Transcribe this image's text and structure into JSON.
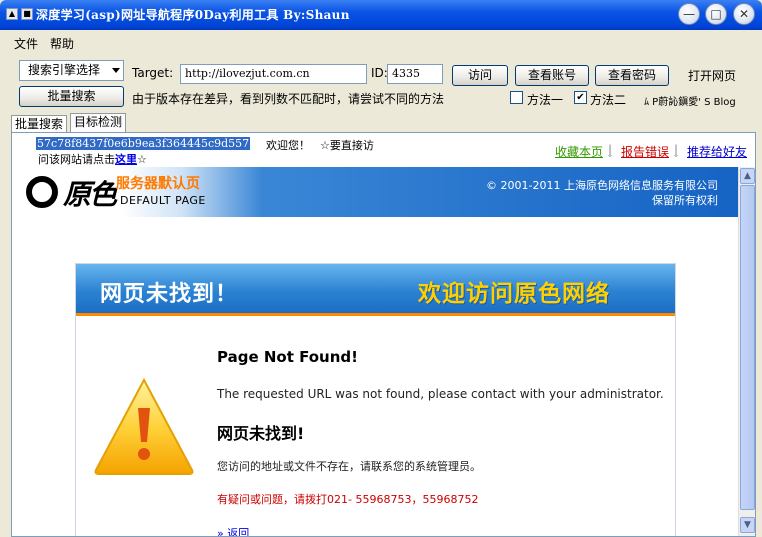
{
  "window": {
    "title": "深度学习(asp)网址导航程序0Day利用工具 By:Shaun",
    "controls": {
      "minimize": "—",
      "maximize": "□",
      "close": "✕"
    }
  },
  "menu": {
    "items": [
      "文件",
      "帮助"
    ]
  },
  "toolbar": {
    "search_engine_select": "搜索引擎选择",
    "target_label": "Target:",
    "target_value": "http://ilovezjut.com.cn",
    "id_label": "ID:",
    "id_value": "4335",
    "visit_button": "访问",
    "view_account_button": "查看账号",
    "view_password_button": "查看密码",
    "open_page_button": "打开网页",
    "batch_search_button": "批量搜索",
    "notice": "由于版本存在差异，看到列数不匹配时，请尝试不同的方法",
    "method1_label": "方法一",
    "method1_checked": false,
    "method2_label": "方法二",
    "method2_checked": true,
    "blog_text": "ﾑ P蔚訫鎭愛' S Blog"
  },
  "tabs": [
    "批量搜索",
    "目标检测"
  ],
  "browser": {
    "hash": "57c78f8437f0e6b9ea3f364445c9d557",
    "welcome": "欢迎您！",
    "direct": "☆要直接访",
    "visit_prefix": "问该网站请点击",
    "visit_link": "这里",
    "visit_suffix": "☆",
    "links": [
      "收藏本页",
      "报告错误",
      "推荐给好友"
    ],
    "link_colors": [
      "#339900",
      "#cc0000",
      "#0000cc"
    ],
    "logo_text": "原色",
    "server_title": "服务器默认页",
    "default_page": "DEFAULT PAGE",
    "copyright1": "© 2001-2011 上海原色网络信息服务有限公司",
    "copyright2": "保留所有权利",
    "error_header_left": "网页未找到！",
    "error_header_right": "欢迎访问原色网络",
    "page_not_found": "Page Not Found!",
    "requested_url": "The requested URL was not found, please contact with your administrator.",
    "cn_not_found": "网页未找到!",
    "cn_requested": "您访问的地址或文件不存在，请联系您的系统管理员。",
    "contact": "有疑问或问题，请拨打021- 55968753，55968752",
    "back": "» 返回"
  }
}
